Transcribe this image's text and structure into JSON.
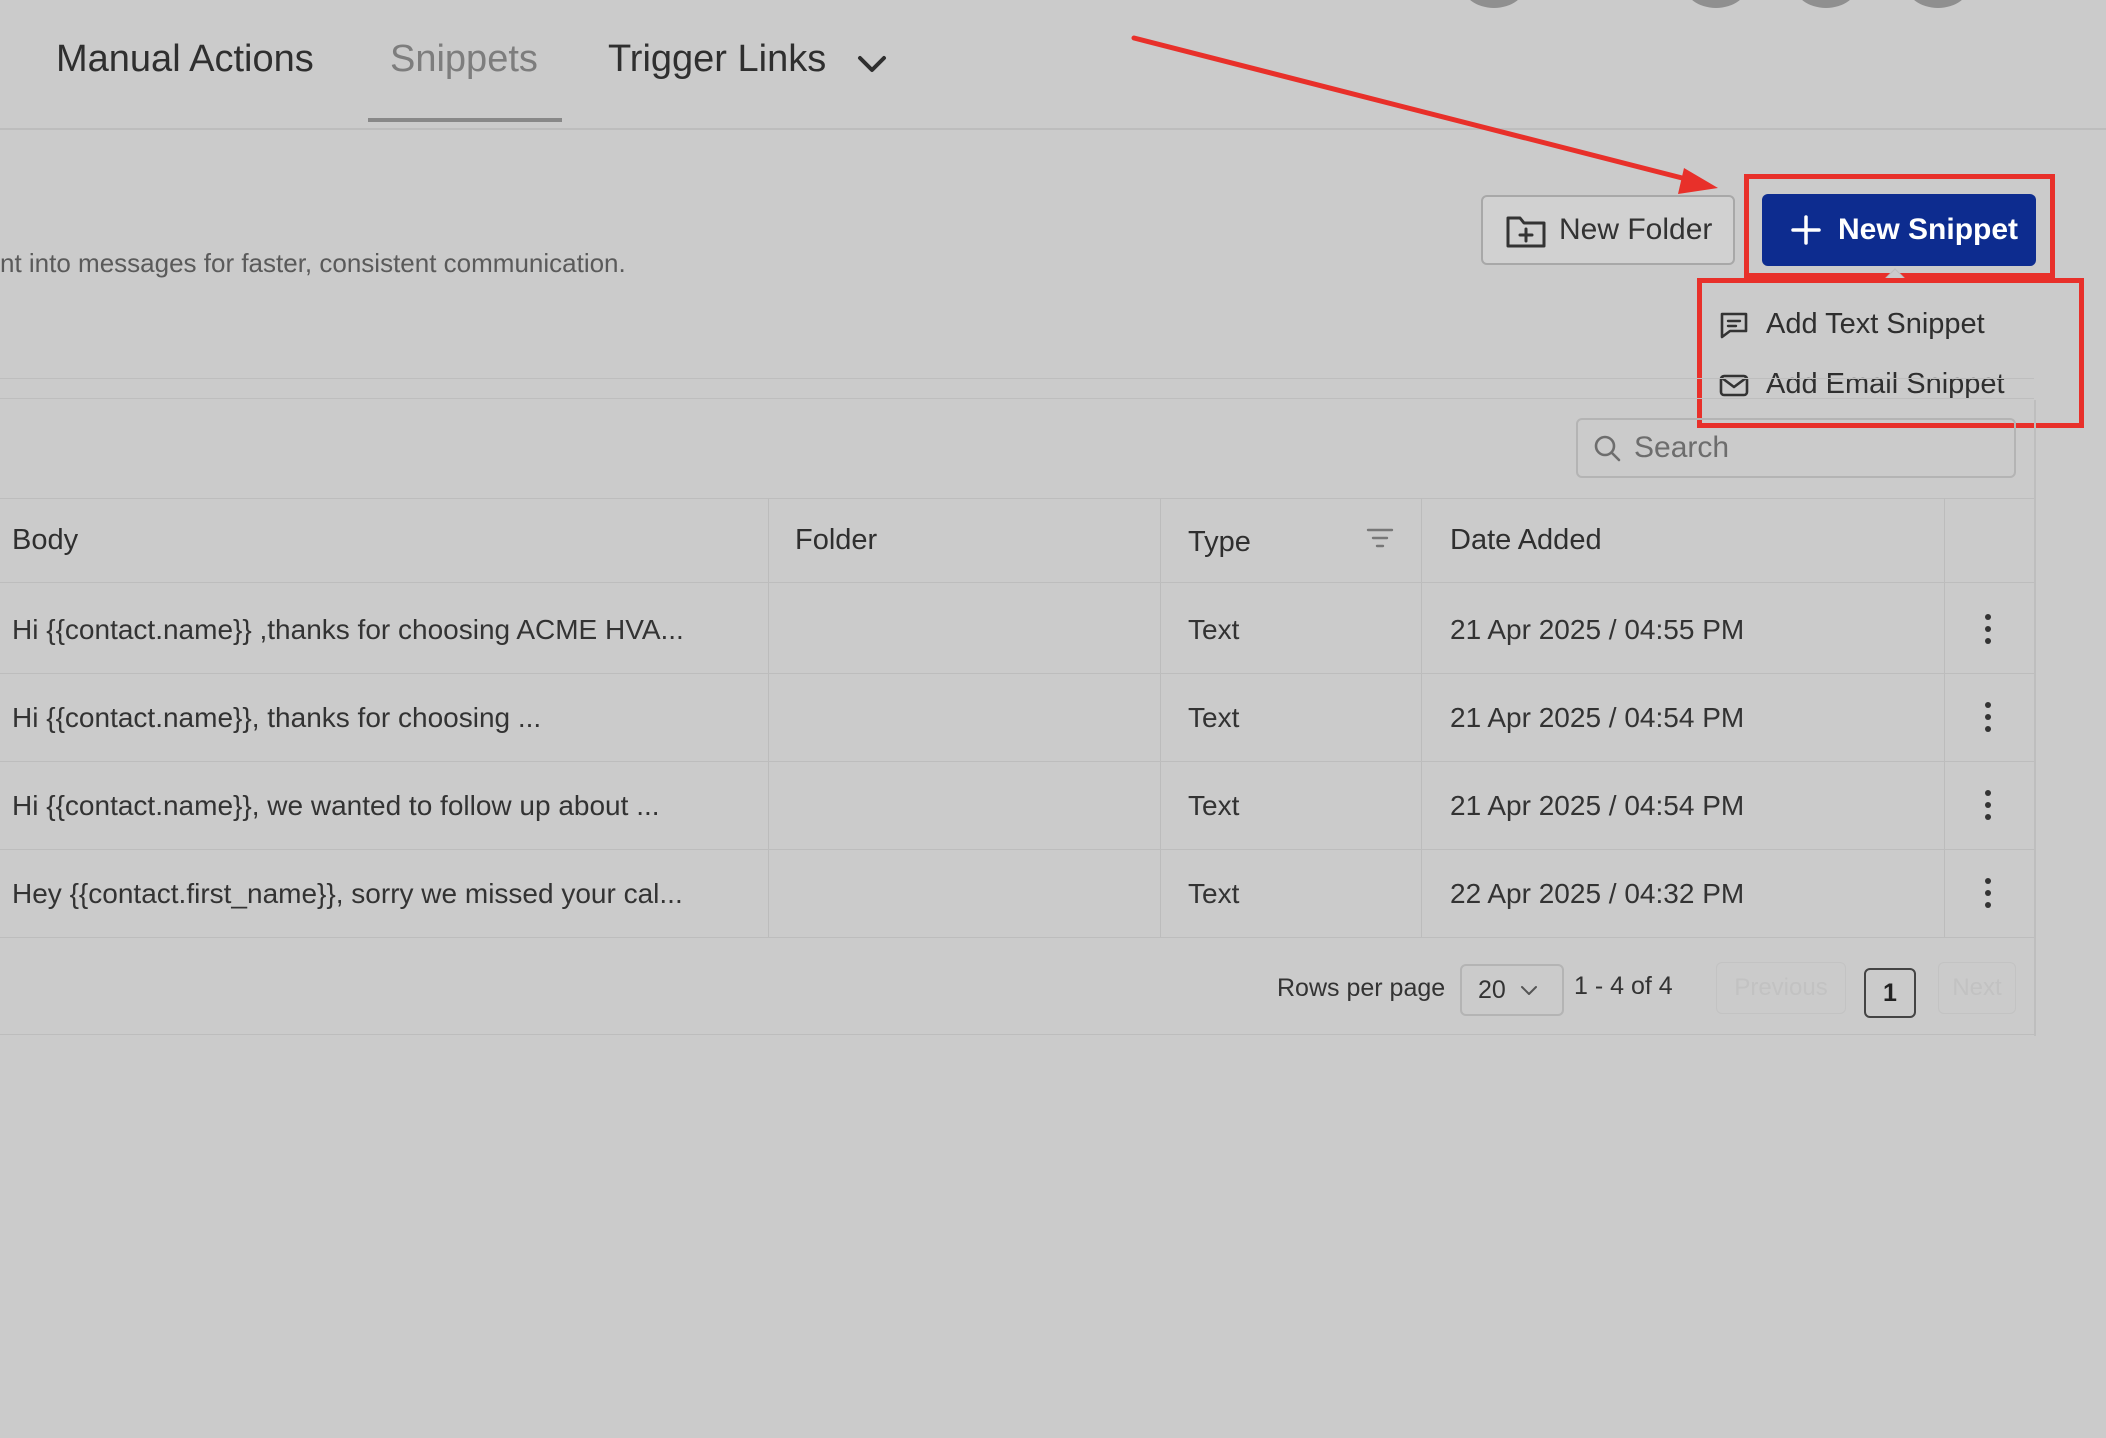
{
  "nav": {
    "tabs": [
      {
        "label": "Manual Actions"
      },
      {
        "label": "Snippets",
        "active": true
      },
      {
        "label": "Trigger Links"
      }
    ]
  },
  "header": {
    "subtitle": "nt into messages for faster, consistent communication."
  },
  "actions": {
    "new_folder_label": "New Folder",
    "new_snippet_label": "New Snippet",
    "primary_color": "#0d2c8f",
    "highlight_color": "#e8302a",
    "menu": [
      {
        "label": "Add Text Snippet",
        "icon": "message-square-icon"
      },
      {
        "label": "Add Email Snippet",
        "icon": "mail-icon"
      }
    ]
  },
  "search": {
    "placeholder": "Search"
  },
  "table": {
    "columns": [
      "Body",
      "Folder",
      "Type",
      "Date Added"
    ],
    "rows": [
      {
        "body": "Hi {{contact.name}} ,thanks for choosing ACME HVA...",
        "folder": "",
        "type": "Text",
        "date_added": "21 Apr 2025 / 04:55 PM"
      },
      {
        "body": "Hi {{contact.name}}, thanks for choosing ...",
        "folder": "",
        "type": "Text",
        "date_added": "21 Apr 2025 / 04:54 PM"
      },
      {
        "body": "Hi {{contact.name}}, we wanted to follow up about ...",
        "folder": "",
        "type": "Text",
        "date_added": "21 Apr 2025 / 04:54 PM"
      },
      {
        "body": "Hey {{contact.first_name}}, sorry we missed your cal...",
        "folder": "",
        "type": "Text",
        "date_added": "22 Apr 2025 / 04:32 PM"
      }
    ]
  },
  "pagination": {
    "rows_per_page_label": "Rows per page",
    "rows_per_page_value": "20",
    "range_text": "1 - 4 of 4",
    "previous_label": "Previous",
    "next_label": "Next",
    "current_page": "1"
  }
}
